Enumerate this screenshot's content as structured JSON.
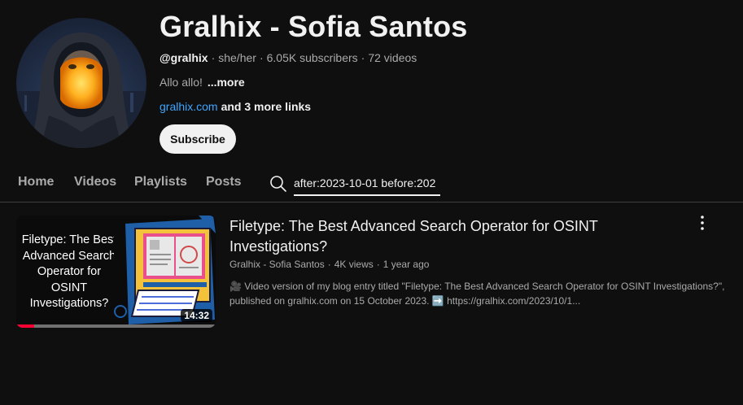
{
  "channel": {
    "name": "Gralhix - Sofia Santos",
    "handle": "@gralhix",
    "pronouns": "she/her",
    "subscribers": "6.05K subscribers",
    "videos": "72 videos",
    "description": "Allo allo!",
    "more_label": "...more",
    "link": "gralhix.com",
    "more_links": "and 3 more links",
    "subscribe_label": "Subscribe"
  },
  "tabs": [
    {
      "label": "Home"
    },
    {
      "label": "Videos"
    },
    {
      "label": "Playlists"
    },
    {
      "label": "Posts"
    }
  ],
  "search": {
    "value": "after:2023-10-01 before:202",
    "icon": "search-icon"
  },
  "video": {
    "thumbnail_text": "Filetype: The Best Advanced Search Operator for OSINT Investigations?",
    "duration": "14:32",
    "watched_fraction": 0.09,
    "title": "Filetype: The Best Advanced Search Operator for OSINT Investigations?",
    "channel": "Gralhix - Sofia Santos",
    "views": "4K views",
    "age": "1 year ago",
    "description": "🎥 Video version of my blog entry titled \"Filetype: The Best Advanced Search Operator for OSINT Investigations?\", published on gralhix.com on 15 October 2023. ➡️ https://gralhix.com/2023/10/1..."
  },
  "colors": {
    "background": "#0f0f0f",
    "link": "#3ea6ff",
    "progress": "#ff0033"
  }
}
